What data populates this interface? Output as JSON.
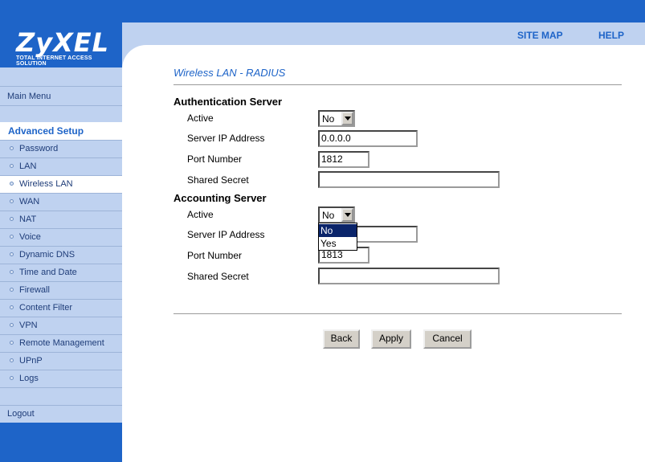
{
  "brand": {
    "logo": "ZyXEL",
    "tagline": "TOTAL INTERNET ACCESS SOLUTION"
  },
  "topnav": {
    "site_map": "SITE MAP",
    "help": "HELP"
  },
  "sidebar": {
    "main_menu": "Main Menu",
    "section": "Advanced Setup",
    "items": [
      {
        "label": "Password"
      },
      {
        "label": "LAN"
      },
      {
        "label": "Wireless LAN"
      },
      {
        "label": "WAN"
      },
      {
        "label": "NAT"
      },
      {
        "label": "Voice"
      },
      {
        "label": "Dynamic DNS"
      },
      {
        "label": "Time and Date"
      },
      {
        "label": "Firewall"
      },
      {
        "label": "Content Filter"
      },
      {
        "label": "VPN"
      },
      {
        "label": "Remote Management"
      },
      {
        "label": "UPnP"
      },
      {
        "label": "Logs"
      }
    ],
    "logout": "Logout"
  },
  "page_title": "Wireless LAN - RADIUS",
  "auth": {
    "heading": "Authentication Server",
    "active_label": "Active",
    "active_value": "No",
    "ip_label": "Server IP Address",
    "ip_value": "0.0.0.0",
    "port_label": "Port Number",
    "port_value": "1812",
    "secret_label": "Shared Secret",
    "secret_value": ""
  },
  "acct": {
    "heading": "Accounting Server",
    "active_label": "Active",
    "active_value": "No",
    "ip_label": "Server IP Address",
    "ip_value": "",
    "port_label": "Port Number",
    "port_value": "1813",
    "secret_label": "Shared Secret",
    "secret_value": ""
  },
  "dropdown_options": [
    "No",
    "Yes"
  ],
  "buttons": {
    "back": "Back",
    "apply": "Apply",
    "cancel": "Cancel"
  }
}
